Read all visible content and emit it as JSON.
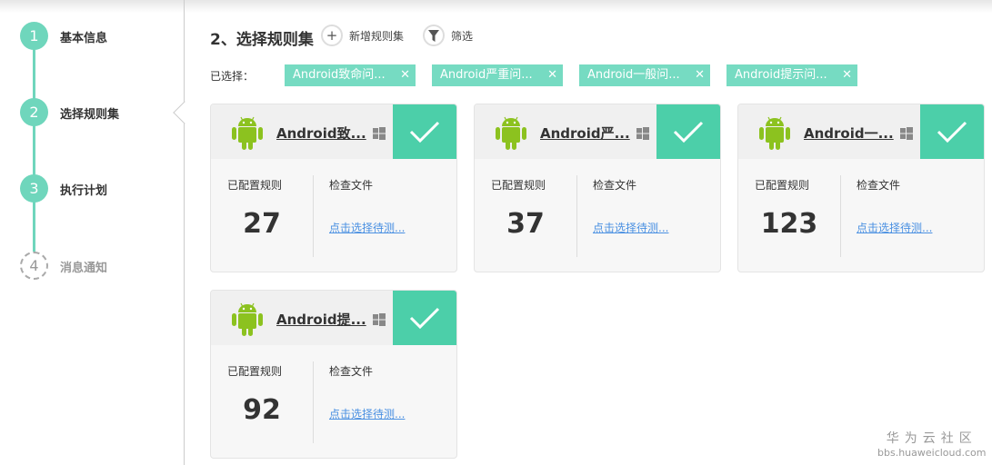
{
  "steps": [
    {
      "num": "1",
      "label": "基本信息"
    },
    {
      "num": "2",
      "label": "选择规则集"
    },
    {
      "num": "3",
      "label": "执行计划"
    },
    {
      "num": "4",
      "label": "消息通知"
    }
  ],
  "header": {
    "title": "2、选择规则集",
    "add_label": "新增规则集",
    "filter_label": "筛选"
  },
  "selected": {
    "label": "已选择：",
    "tags": [
      "Android致命问...",
      "Android严重问...",
      "Android一般问...",
      "Android提示问..."
    ]
  },
  "cards": [
    {
      "name": "Android致...",
      "rules_label": "已配置规则",
      "rules": "27",
      "files_label": "检查文件",
      "files_link": "点击选择待测..."
    },
    {
      "name": "Android严...",
      "rules_label": "已配置规则",
      "rules": "37",
      "files_label": "检查文件",
      "files_link": "点击选择待测..."
    },
    {
      "name": "Android一...",
      "rules_label": "已配置规则",
      "rules": "123",
      "files_label": "检查文件",
      "files_link": "点击选择待测..."
    },
    {
      "name": "Android提...",
      "rules_label": "已配置规则",
      "rules": "92",
      "files_label": "检查文件",
      "files_link": "点击选择待测..."
    }
  ],
  "watermark": {
    "line1": "华为云社区",
    "line2": "bbs.huaweicloud.com"
  },
  "colors": {
    "accent": "#4ccfa9",
    "tag": "#76dbc2",
    "link": "#4a90e2"
  }
}
